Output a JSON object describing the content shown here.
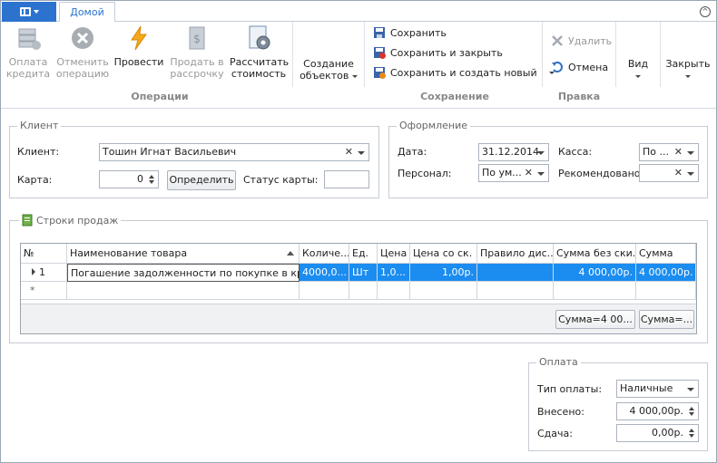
{
  "tabs": {
    "home": "Домой"
  },
  "ribbon": {
    "operations": {
      "group_label": "Операции",
      "pay_credit": "Оплата кредита",
      "cancel_operation": "Отменить операцию",
      "post": "Провести",
      "sell_installment": "Продать в рассрочку",
      "calc_cost": "Рассчитать стоимость",
      "create_objects": "Создание объектов"
    },
    "save": {
      "group_label": "Сохранение",
      "save": "Сохранить",
      "save_close": "Сохранить и закрыть",
      "save_new": "Сохранить и создать новый"
    },
    "edit": {
      "group_label": "Правка",
      "delete": "Удалить",
      "cancel": "Отмена"
    },
    "view": "Вид",
    "close": "Закрыть"
  },
  "client_group": {
    "title": "Клиент",
    "client_label": "Клиент:",
    "client_value": "Тошин Игнат Васильевич",
    "card_label": "Карта:",
    "card_value": "0",
    "detect_button": "Определить",
    "card_status_label": "Статус карты:",
    "card_status_value": ""
  },
  "design_group": {
    "title": "Оформление",
    "date_label": "Дата:",
    "date_value": "31.12.2014",
    "cashbox_label": "Касса:",
    "cashbox_value": "По ...",
    "staff_label": "Персонал:",
    "staff_value": "По ум...",
    "recommended_label": "Рекомендовано:",
    "recommended_value": ""
  },
  "sales_rows": {
    "title": "Строки продаж",
    "columns": [
      "№",
      "Наименование товара",
      "Количе...",
      "Ед.",
      "Цена",
      "Цена со ск.",
      "Правило дис...",
      "Сумма без ски...",
      "Сумма"
    ],
    "rows": [
      {
        "num": "1",
        "name": "Погашение задолженности по покупке в кредит",
        "qty": "4000,0...",
        "unit": "Шт",
        "price": "1,0...",
        "price_disc": "1,00р.",
        "rule": "",
        "sum_nodisc": "4 000,00р.",
        "sum": "4 000,00р."
      }
    ],
    "new_row_marker": "*",
    "summary_sum_nodisc": "Сумма=4 00...",
    "summary_sum": "Сумма=..."
  },
  "payment_group": {
    "title": "Оплата",
    "type_label": "Тип оплаты:",
    "type_value": "Наличные",
    "paid_label": "Внесено:",
    "paid_value": "4 000,00р.",
    "change_label": "Сдача:",
    "change_value": "0,00р."
  }
}
